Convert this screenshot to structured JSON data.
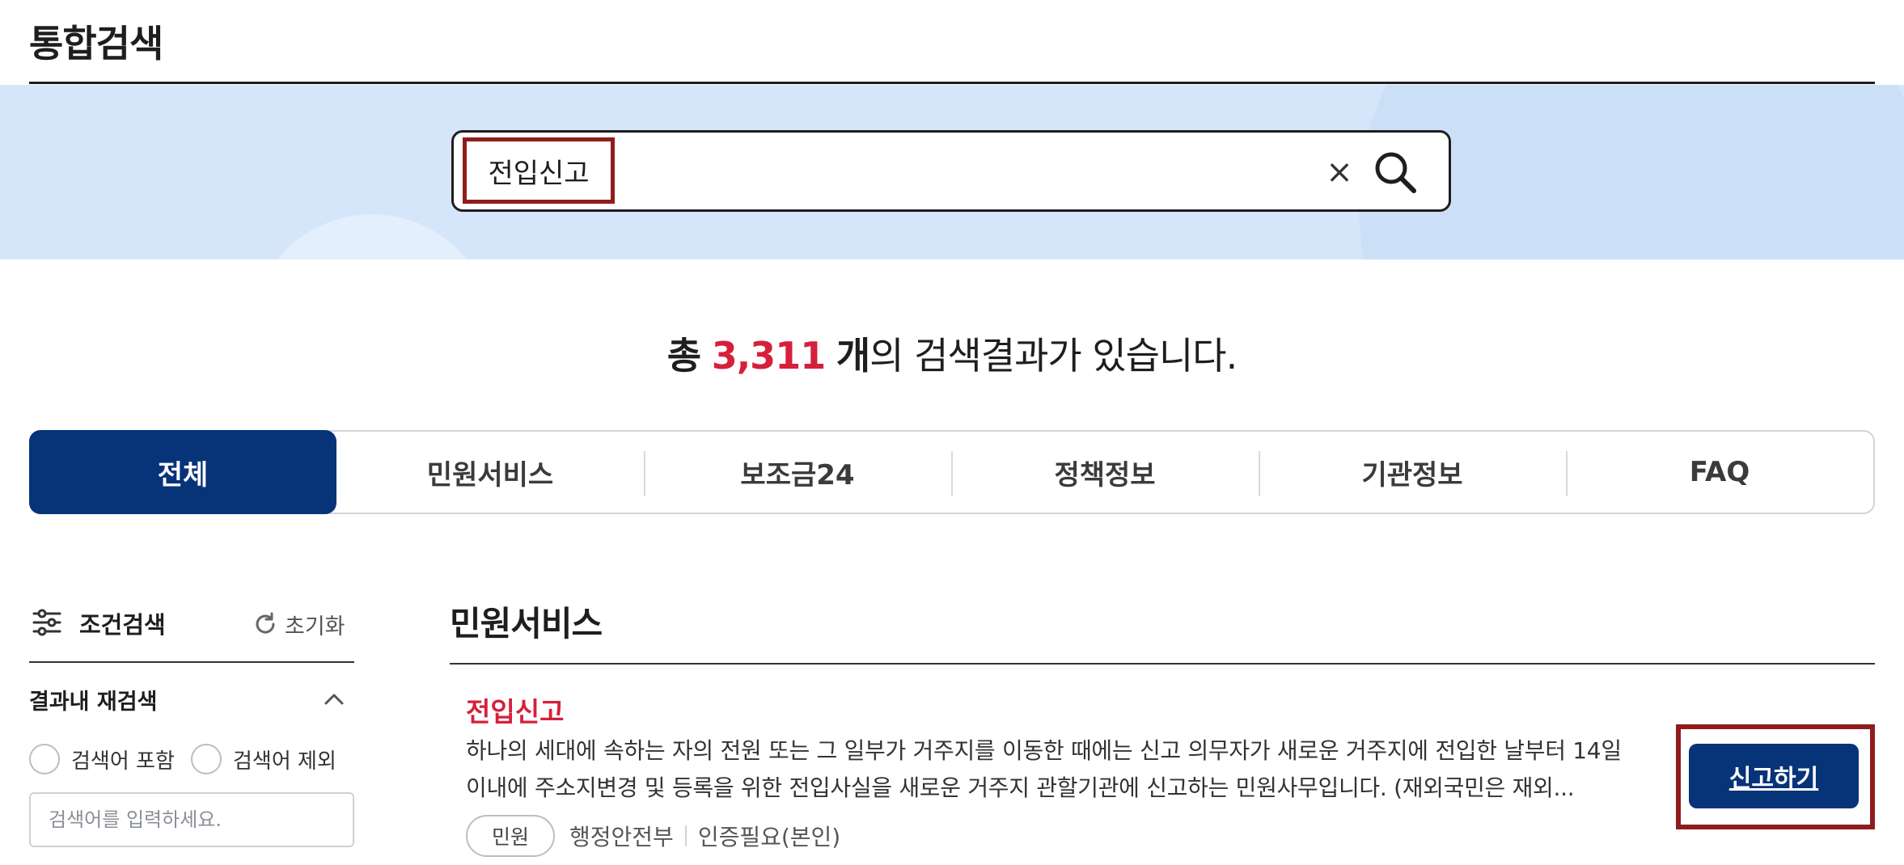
{
  "page": {
    "title": "통합검색"
  },
  "search": {
    "query": "전입신고",
    "clear_label": "×"
  },
  "summary": {
    "prefix": "총",
    "count": "3,311",
    "unit": "개",
    "suffix": "의 검색결과가 있습니다."
  },
  "tabs": [
    {
      "label": "전체",
      "active": true
    },
    {
      "label": "민원서비스",
      "active": false
    },
    {
      "label": "보조금24",
      "active": false
    },
    {
      "label": "정책정보",
      "active": false
    },
    {
      "label": "기관정보",
      "active": false
    },
    {
      "label": "FAQ",
      "active": false
    }
  ],
  "filter": {
    "title": "조건검색",
    "reset_label": "초기화",
    "research_title": "결과내 재검색",
    "include_label": "검색어 포함",
    "exclude_label": "검색어 제외",
    "input_placeholder": "검색어를 입력하세요."
  },
  "section": {
    "title": "민원서비스"
  },
  "result": {
    "title": "전입신고",
    "description": "하나의 세대에 속하는 자의 전원 또는 그 일부가 거주지를 이동한 때에는 신고 의무자가 새로운 거주지에 전입한 날부터 14일 이내에 주소지변경 및 등록을 위한 전입사실을 새로운 거주지 관할기관에 신고하는 민원사무입니다. (재외국민은 재외...",
    "tag": "민원",
    "agency": "행정안전부",
    "auth": "인증필요(본인)",
    "action_label": "신고하기"
  },
  "colors": {
    "primary": "#073379",
    "accent_red": "#d6203b",
    "band": "#d5e6fa",
    "highlight_border": "#8f1d1d"
  }
}
